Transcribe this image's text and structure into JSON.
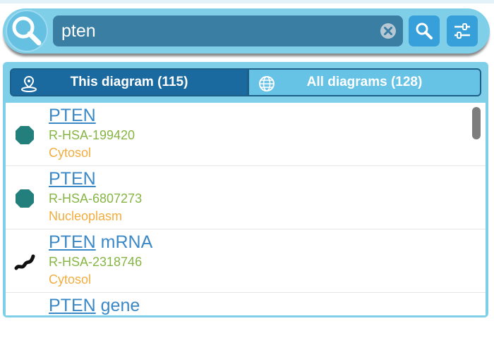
{
  "search": {
    "value": "pten",
    "placeholder": "",
    "icons": {
      "leading": "search-icon",
      "clear": "close-icon",
      "submit": "search-icon",
      "options": "sliders-icon"
    }
  },
  "tabs": [
    {
      "label": "This diagram (115)",
      "icon": "location-pin-icon",
      "active": true
    },
    {
      "label": "All diagrams (128)",
      "icon": "globe-icon",
      "active": false
    }
  ],
  "results": [
    {
      "match": "PTEN",
      "suffix": "",
      "id": "R-HSA-199420",
      "location": "Cytosol",
      "icon": "protein-octagon-icon"
    },
    {
      "match": "PTEN",
      "suffix": "",
      "id": "R-HSA-6807273",
      "location": "Nucleoplasm",
      "icon": "protein-octagon-icon"
    },
    {
      "match": "PTEN",
      "suffix": " mRNA",
      "id": "R-HSA-2318746",
      "location": "Cytosol",
      "icon": "rna-squiggle-icon"
    },
    {
      "match": "PTEN",
      "suffix": " gene",
      "id": "",
      "location": "",
      "icon": ""
    }
  ],
  "colors": {
    "accent": "#7fcfe9",
    "tab_active": "#1a6aa0",
    "tab_inactive": "#67c3e6",
    "link": "#3b88c6",
    "identifier": "#86b544",
    "compartment": "#f1ad3f",
    "protein": "#237f7c"
  }
}
